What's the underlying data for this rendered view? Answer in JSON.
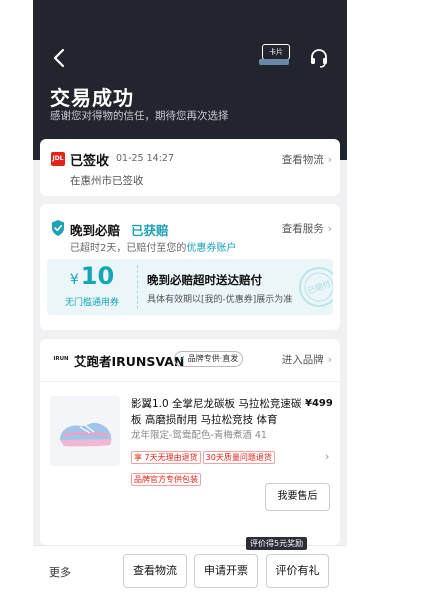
{
  "header": {
    "card_label": "卡片",
    "title": "交易成功",
    "subtitle": "感谢您对得物的信任，期待您再次选择"
  },
  "logistics": {
    "logo_text": "JDL",
    "status": "已签收",
    "time": "01-25  14:27",
    "link": "查看物流",
    "location": "在惠州市已签收"
  },
  "compensation": {
    "title": "晚到必赔",
    "status": "已获赔",
    "desc_prefix": "已超时2天，已赔付至您的",
    "desc_highlight": "优惠券账户",
    "link": "查看服务",
    "coupon": {
      "currency": "¥",
      "amount": "10",
      "threshold": "无门槛通用券",
      "title": "晚到必赔超时送达赔付",
      "desc": "具体有效期以[我的-优惠券]展示为准",
      "stamp": "已赔付"
    }
  },
  "order": {
    "brand_logo": "IRUN",
    "brand_name": "艾跑者IRUNSVAN",
    "brand_badge": "品牌专供·直发",
    "brand_link": "进入品牌",
    "product": {
      "name": "影翼1.0 全掌尼龙碳板 马拉松竞速碳板 高磨损耐用 马拉松竞技 体育",
      "price": "¥499",
      "spec": "龙年限定-鸳鸯配色-青梅煮酒 41",
      "tags": [
        "享 7天无理由退货",
        "30天质量问题退货",
        "品牌官方专供包装"
      ]
    },
    "after_sale": "我要售后"
  },
  "bottom_bar": {
    "more": "更多",
    "buttons": [
      "查看物流",
      "申请开票",
      "评价有礼"
    ],
    "reward_tip": "评价得5元奖励"
  },
  "colors": {
    "header_bg": "#22242e",
    "accent": "#1ea2b6",
    "warning_red": "#e2231a"
  },
  "icons": [
    "back-arrow-icon",
    "card-icon",
    "customer-service-icon",
    "jdl-logo-icon",
    "shield-check-icon",
    "chevron-right-icon",
    "brand-logo-icon",
    "verified-icon"
  ]
}
